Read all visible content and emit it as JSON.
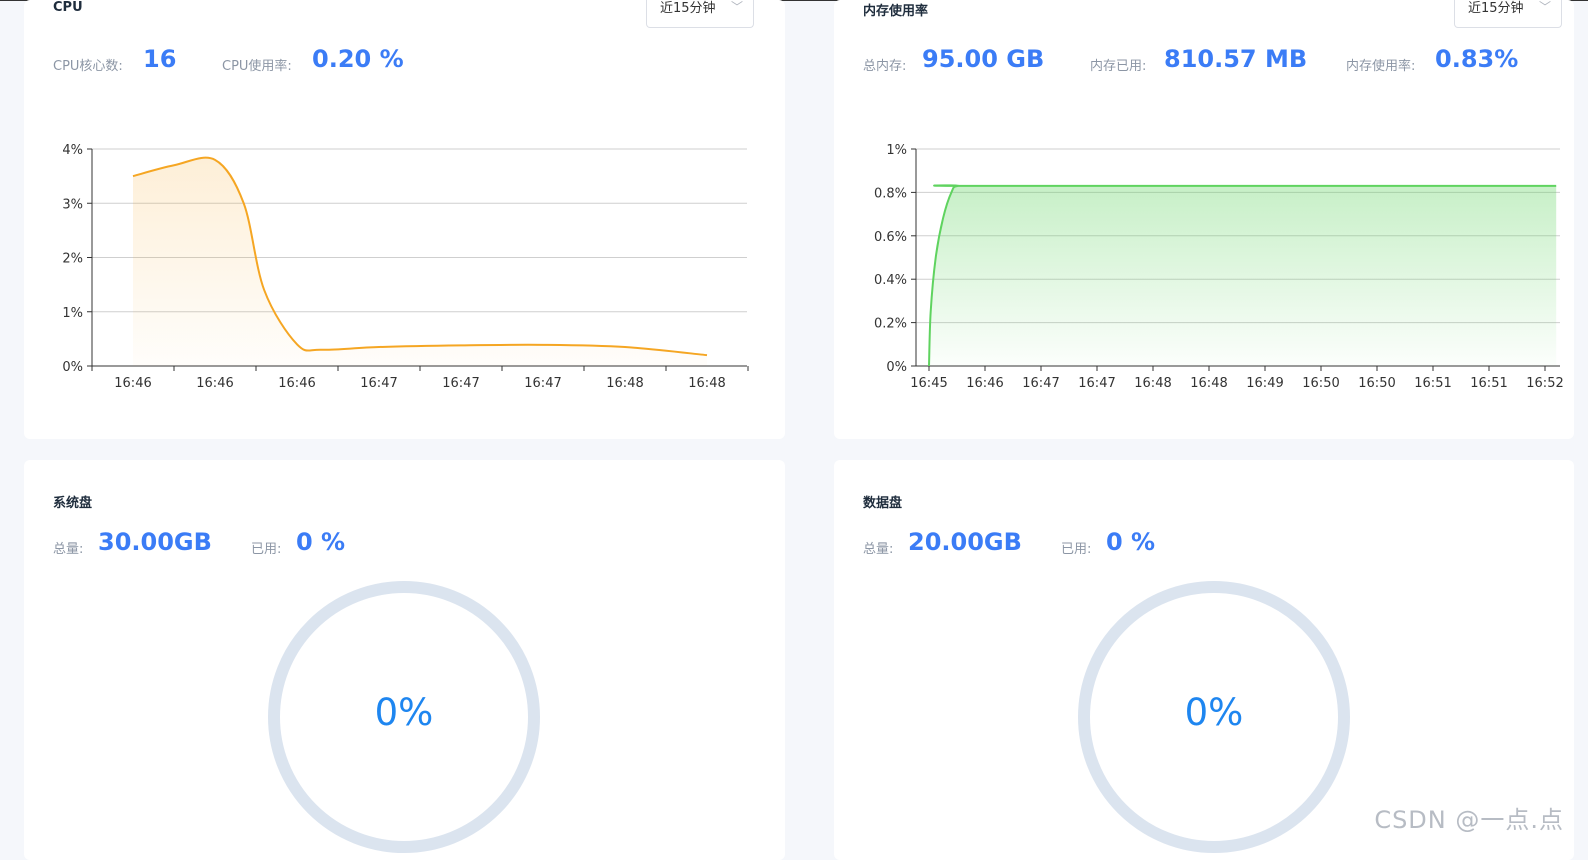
{
  "cpu": {
    "title": "CPU",
    "range_select": "近15分钟",
    "cores_label": "CPU核心数:",
    "cores_value": "16",
    "usage_label": "CPU使用率:",
    "usage_value": "0.20 %"
  },
  "memory": {
    "title": "内存使用率",
    "range_select": "近15分钟",
    "total_label": "总内存:",
    "total_value": "95.00 GB",
    "used_label": "内存已用:",
    "used_value": "810.57 MB",
    "usage_label": "内存使用率:",
    "usage_value": "0.83%"
  },
  "system_disk": {
    "title": "系统盘",
    "total_label": "总量:",
    "total_value": "30.00GB",
    "used_label": "已用:",
    "used_value": "0 %",
    "ring_text": "0%",
    "percent": 0
  },
  "data_disk": {
    "title": "数据盘",
    "total_label": "总量:",
    "total_value": "20.00GB",
    "used_label": "已用:",
    "used_value": "0 %",
    "ring_text": "0%",
    "percent": 0
  },
  "watermark": "CSDN @一点.点",
  "colors": {
    "accent": "#3b7cf6",
    "cpu_line": "#f5a623",
    "mem_line": "#5fd35f",
    "ring_track": "#dbe4ef",
    "ring_text": "#1e86f0"
  },
  "chart_data": [
    {
      "type": "area",
      "name": "cpu-chart",
      "categories": [
        "16:46",
        "16:46",
        "16:46",
        "16:47",
        "16:47",
        "16:47",
        "16:48",
        "16:48"
      ],
      "yticks": [
        "0%",
        "1%",
        "2%",
        "3%",
        "4%"
      ],
      "ylim": [
        0,
        4
      ],
      "x": [
        0,
        0.5,
        1,
        1.35,
        1.6,
        2,
        2.3,
        3,
        4,
        5,
        6,
        7
      ],
      "values": [
        3.5,
        3.7,
        3.8,
        3.0,
        1.4,
        0.4,
        0.3,
        0.35,
        0.38,
        0.39,
        0.35,
        0.2
      ],
      "grid": true,
      "color": "#f5a623"
    },
    {
      "type": "area",
      "name": "memory-chart",
      "categories": [
        "16:45",
        "16:46",
        "16:47",
        "16:47",
        "16:48",
        "16:48",
        "16:49",
        "16:50",
        "16:50",
        "16:51",
        "16:51",
        "16:52"
      ],
      "yticks": [
        "0%",
        "0.2%",
        "0.4%",
        "0.6%",
        "0.8%",
        "1%"
      ],
      "ylim": [
        0,
        1
      ],
      "x": [
        0,
        0.03,
        0.12,
        0.25,
        0.4,
        0.52,
        1,
        11.2
      ],
      "values": [
        0,
        0.25,
        0.5,
        0.68,
        0.8,
        0.83,
        0.83,
        0.83
      ],
      "grid": true,
      "color": "#5fd35f"
    }
  ]
}
